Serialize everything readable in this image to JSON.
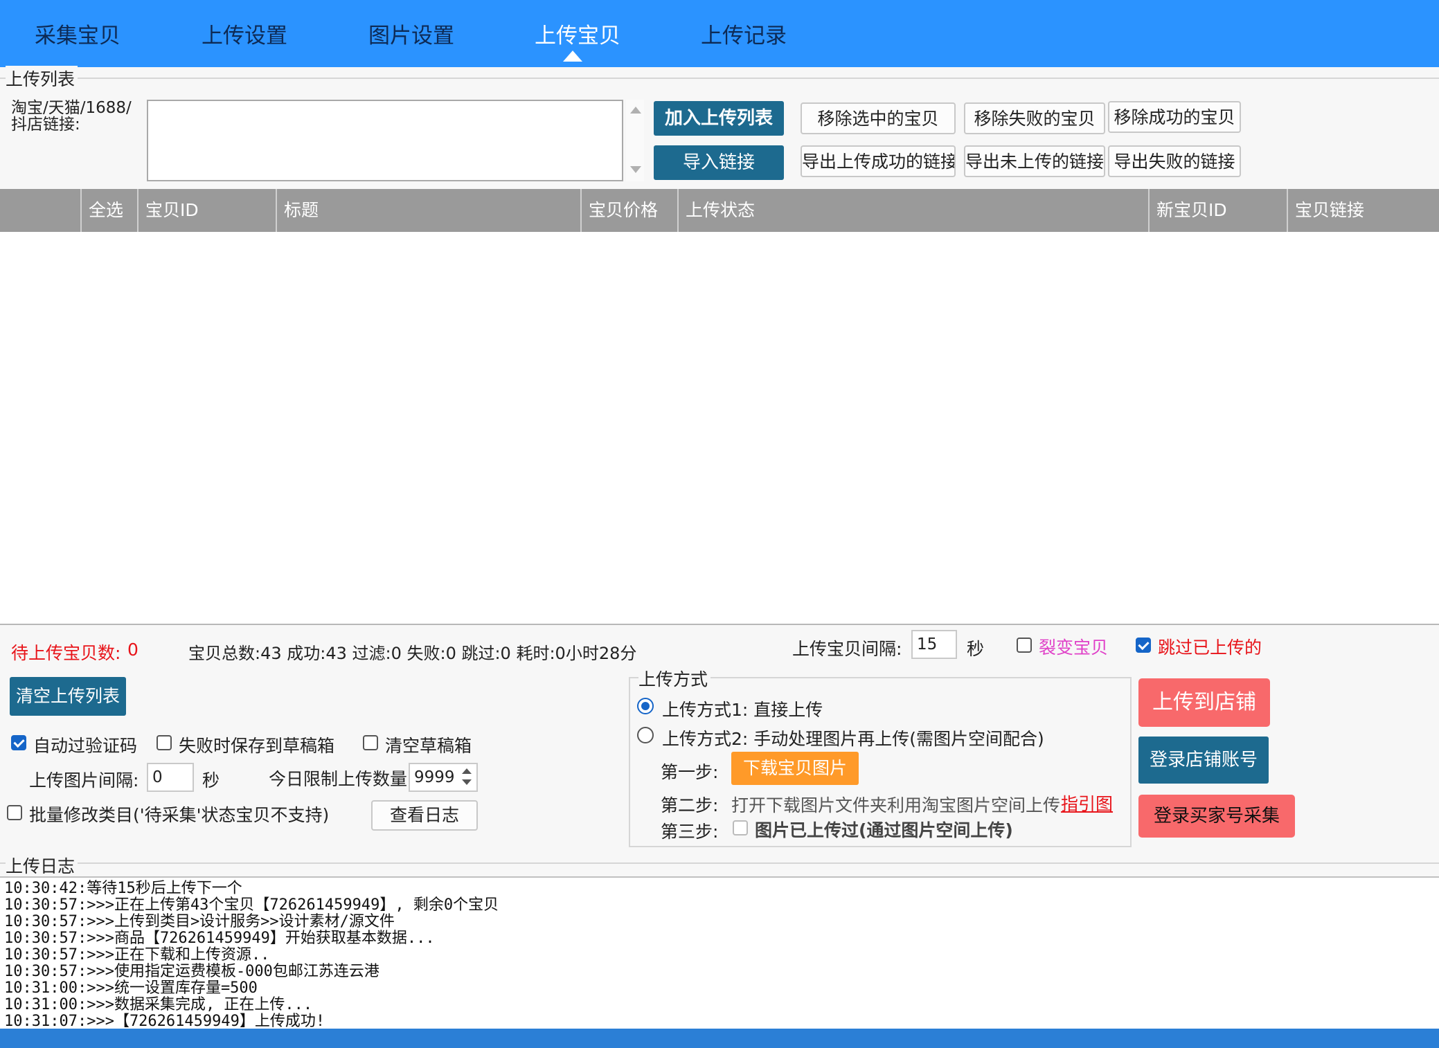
{
  "nav": {
    "tabs": [
      "采集宝贝",
      "上传设置",
      "图片设置",
      "上传宝贝",
      "上传记录"
    ],
    "active_index": 3
  },
  "upload_list": {
    "group_label": "上传列表",
    "link_label_line1": "淘宝/天猫/1688/",
    "link_label_line2": "抖店链接:",
    "link_input_value": "",
    "add_button": "加入上传列表",
    "import_button": "导入链接",
    "remove_selected": "移除选中的宝贝",
    "remove_failed": "移除失败的宝贝",
    "remove_success": "移除成功的宝贝",
    "export_success": "导出上传成功的链接",
    "export_not_uploaded": "导出未上传的链接",
    "export_failed": "导出失败的链接"
  },
  "table": {
    "columns": [
      "全选",
      "宝贝ID",
      "标题",
      "宝贝价格",
      "上传状态",
      "新宝贝ID",
      "宝贝链接"
    ],
    "rows": []
  },
  "stats": {
    "pending_label": "待上传宝贝数:",
    "pending_value": "0",
    "summary": "宝贝总数:43  成功:43 过滤:0 失败:0 跳过:0 耗时:0小时28分",
    "interval_label": "上传宝贝间隔:",
    "interval_value": "15",
    "interval_unit": "秒",
    "fission_label": "裂变宝贝",
    "fission_checked": false,
    "skip_uploaded_label": "跳过已上传的",
    "skip_uploaded_checked": true
  },
  "options": {
    "clear_list_button": "清空上传列表",
    "auto_captcha_label": "自动过验证码",
    "auto_captcha_checked": true,
    "save_draft_label": "失败时保存到草稿箱",
    "save_draft_checked": false,
    "clear_draft_label": "清空草稿箱",
    "clear_draft_checked": false,
    "image_interval_label": "上传图片间隔:",
    "image_interval_value": "0",
    "image_interval_unit": "秒",
    "daily_limit_label": "今日限制上传数量",
    "daily_limit_value": "9999",
    "batch_category_label": "批量修改类目('待采集'状态宝贝不支持)",
    "batch_category_checked": false,
    "view_log_button": "查看日志"
  },
  "upload_method": {
    "group_label": "上传方式",
    "method1": "上传方式1: 直接上传",
    "method2": "上传方式2: 手动处理图片再上传(需图片空间配合)",
    "selected": 1,
    "step1_label": "第一步:",
    "step1_button": "下载宝贝图片",
    "step2_label": "第二步:",
    "step2_text": "打开下载图片文件夹利用淘宝图片空间上传",
    "step2_link": "指引图",
    "step3_label": "第三步:",
    "step3_check_label": "图片已上传过(通过图片空间上传)",
    "step3_checked": false
  },
  "actions": {
    "upload_to_store": "上传到店铺",
    "login_store": "登录店铺账号",
    "login_buyer": "登录买家号采集"
  },
  "log": {
    "group_label": "上传日志",
    "lines": [
      "10:30:42:等待15秒后上传下一个",
      "10:30:57:>>>正在上传第43个宝贝【726261459949】, 剩余0个宝贝",
      "10:30:57:>>>上传到类目>设计服务>>设计素材/源文件",
      "10:30:57:>>>商品【726261459949】开始获取基本数据...",
      "10:30:57:>>>正在下载和上传资源..",
      "10:30:57:>>>使用指定运费模板-000包邮江苏连云港",
      "10:31:00:>>>统一设置库存量=500",
      "10:31:00:>>>数据采集完成, 正在上传...",
      "10:31:07:>>>【726261459949】上传成功!"
    ]
  },
  "colors": {
    "nav_bg": "#2b93ff",
    "teal_button": "#1d6a8f",
    "red_button": "#f8696b",
    "orange_button": "#ff9a29",
    "table_header": "#9a9a9a",
    "pending_red": "#e8141a",
    "fission_magenta": "#e040c8"
  }
}
